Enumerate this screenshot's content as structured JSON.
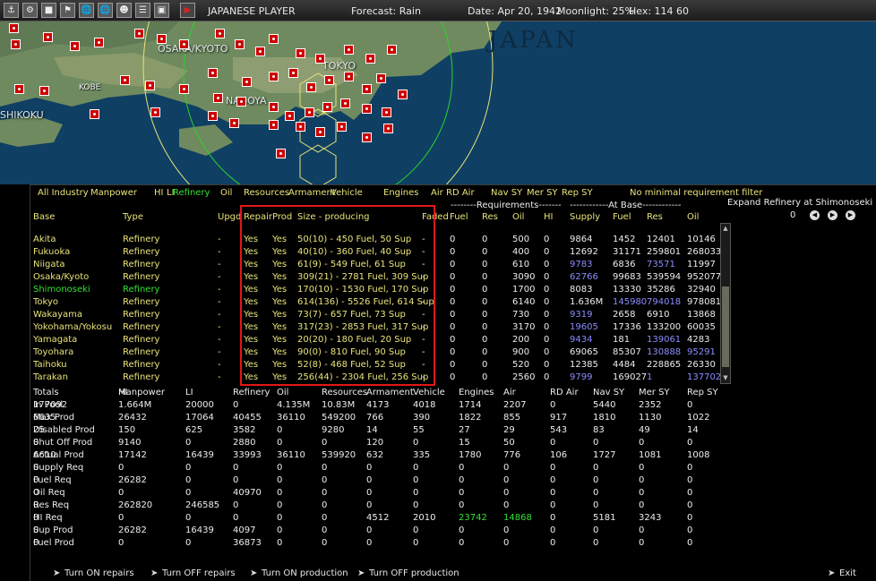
{
  "topbar": {
    "player": "JAPANESE PLAYER",
    "forecast": "Forecast: Rain",
    "date": "Date: Apr 20, 1942",
    "moonlight": "Moonlight: 25%",
    "hex": "Hex: 114 60",
    "icons": [
      "ship-icon",
      "tools-icon",
      "building-icon",
      "flag-icon",
      "globe-icon",
      "globe-icon",
      "manpower-icon",
      "list-icon",
      "window-icon",
      "play-icon"
    ]
  },
  "map": {
    "title": "JAPAN",
    "cities": [
      "OSAKA/KYOTO",
      "TOKYO",
      "NAGOYA",
      "KOBE",
      "SHIKOKU"
    ]
  },
  "filters": [
    "All Industry",
    "Manpower",
    "HI",
    "LI",
    "Refinery",
    "Oil",
    "Resources",
    "Armament",
    "Vehicle",
    "Engines",
    "Air",
    "RD Air",
    "Nav SY",
    "Mer SY",
    "Rep SY",
    "No minimal requirement filter"
  ],
  "active_filter": "Refinery",
  "expand": {
    "label": "Expand Refinery at Shimonoseki",
    "value": "0"
  },
  "groups": {
    "requirements": "--------Requirements-------",
    "atbase": "------------At Base------------"
  },
  "columns": [
    "Base",
    "Type",
    "Upgd",
    "Repair",
    "Prod",
    "Size - producing",
    "Faded",
    "Fuel",
    "Res",
    "Oil",
    "HI",
    "Supply",
    "Fuel",
    "Res",
    "Oil"
  ],
  "rows": [
    {
      "base": "Akita",
      "type": "Refinery",
      "upg": "-",
      "repair": "Yes",
      "prod": "Yes",
      "size": "50(10) - 450 Fuel, 50 Sup",
      "dmg": "-",
      "req_fuel": "0",
      "req_res": "0",
      "req_oil": "500",
      "req_hi": "0",
      "supply": "9864",
      "fuel": "1452",
      "res": "12401",
      "oil": "10146"
    },
    {
      "base": "Fukuoka",
      "type": "Refinery",
      "upg": "-",
      "repair": "Yes",
      "prod": "Yes",
      "size": "40(10) - 360 Fuel, 40 Sup",
      "dmg": "-",
      "req_fuel": "0",
      "req_res": "0",
      "req_oil": "400",
      "req_hi": "0",
      "supply": "12692",
      "fuel": "31171",
      "res": "259801",
      "oil": "268033"
    },
    {
      "base": "Niigata",
      "type": "Refinery",
      "upg": "-",
      "repair": "Yes",
      "prod": "Yes",
      "size": "61(9) - 549 Fuel, 61 Sup",
      "dmg": "-",
      "req_fuel": "0",
      "req_res": "0",
      "req_oil": "610",
      "req_hi": "0",
      "supply": "9783",
      "fuel": "6836",
      "res": "73571",
      "oil": "11997"
    },
    {
      "base": "Osaka/Kyoto",
      "type": "Refinery",
      "upg": "-",
      "repair": "Yes",
      "prod": "Yes",
      "size": "309(21) - 2781 Fuel, 309 Sup",
      "dmg": "-",
      "req_fuel": "0",
      "req_res": "0",
      "req_oil": "3090",
      "req_hi": "0",
      "supply": "62766",
      "fuel": "99683",
      "res": "539594",
      "oil": "952077"
    },
    {
      "base": "Shimonoseki",
      "type": "Refinery",
      "upg": "-",
      "repair": "Yes",
      "prod": "Yes",
      "size": "170(10) - 1530 Fuel, 170 Sup",
      "dmg": "-",
      "req_fuel": "0",
      "req_res": "0",
      "req_oil": "1700",
      "req_hi": "0",
      "supply": "8083",
      "fuel": "13330",
      "res": "35286",
      "oil": "32940"
    },
    {
      "base": "Tokyo",
      "type": "Refinery",
      "upg": "-",
      "repair": "Yes",
      "prod": "Yes",
      "size": "614(136) - 5526 Fuel, 614 Sup",
      "dmg": "-",
      "req_fuel": "0",
      "req_res": "0",
      "req_oil": "6140",
      "req_hi": "0",
      "supply": "1.636M",
      "fuel": "145980",
      "res": "794018",
      "oil": "978081"
    },
    {
      "base": "Wakayama",
      "type": "Refinery",
      "upg": "-",
      "repair": "Yes",
      "prod": "Yes",
      "size": "73(7) - 657 Fuel, 73 Sup",
      "dmg": "-",
      "req_fuel": "0",
      "req_res": "0",
      "req_oil": "730",
      "req_hi": "0",
      "supply": "9319",
      "fuel": "2658",
      "res": "6910",
      "oil": "13868"
    },
    {
      "base": "Yokohama/Yokosu",
      "type": "Refinery",
      "upg": "-",
      "repair": "Yes",
      "prod": "Yes",
      "size": "317(23) - 2853 Fuel, 317 Sup",
      "dmg": "-",
      "req_fuel": "0",
      "req_res": "0",
      "req_oil": "3170",
      "req_hi": "0",
      "supply": "19605",
      "fuel": "17336",
      "res": "133200",
      "oil": "60035"
    },
    {
      "base": "Yamagata",
      "type": "Refinery",
      "upg": "-",
      "repair": "Yes",
      "prod": "Yes",
      "size": "20(20) - 180 Fuel, 20 Sup",
      "dmg": "-",
      "req_fuel": "0",
      "req_res": "0",
      "req_oil": "200",
      "req_hi": "0",
      "supply": "9434",
      "fuel": "181",
      "res": "139061",
      "oil": "4283"
    },
    {
      "base": "Toyohara",
      "type": "Refinery",
      "upg": "-",
      "repair": "Yes",
      "prod": "Yes",
      "size": "90(0) - 810 Fuel, 90 Sup",
      "dmg": "-",
      "req_fuel": "0",
      "req_res": "0",
      "req_oil": "900",
      "req_hi": "0",
      "supply": "69065",
      "fuel": "85307",
      "res": "130888",
      "oil": "95291"
    },
    {
      "base": "Taihoku",
      "type": "Refinery",
      "upg": "-",
      "repair": "Yes",
      "prod": "Yes",
      "size": "52(8) - 468 Fuel, 52 Sup",
      "dmg": "-",
      "req_fuel": "0",
      "req_res": "0",
      "req_oil": "520",
      "req_hi": "0",
      "supply": "12385",
      "fuel": "4484",
      "res": "228865",
      "oil": "26330"
    },
    {
      "base": "Tarakan",
      "type": "Refinery",
      "upg": "-",
      "repair": "Yes",
      "prod": "Yes",
      "size": "256(44) - 2304 Fuel, 256 Sup",
      "dmg": "-",
      "req_fuel": "0",
      "req_res": "0",
      "req_oil": "2560",
      "req_hi": "0",
      "supply": "9799",
      "fuel": "169027",
      "res": "1",
      "oil": "137702"
    }
  ],
  "totals": {
    "header": [
      "Totals",
      "Manpower",
      "HI",
      "LI",
      "Refinery",
      "Oil",
      "Resources",
      "Armament",
      "Vehicle",
      "Engines",
      "Air",
      "RD Air",
      "Nav SY",
      "Mer SY",
      "Rep SY"
    ],
    "rows": [
      {
        "label": "In Pool",
        "values": [
          "177092",
          "1.664M",
          "20000",
          "0",
          "4.135M",
          "10.83M",
          "4173",
          "4018",
          "1714",
          "2207",
          "0",
          "5440",
          "2352",
          "0"
        ]
      },
      {
        "label": "Max Prod",
        "values": [
          "6635",
          "26432",
          "17064",
          "40455",
          "36110",
          "549200",
          "766",
          "390",
          "1822",
          "855",
          "917",
          "1810",
          "1130",
          "1022"
        ]
      },
      {
        "label": "Disabled Prod",
        "values": [
          "25",
          "150",
          "625",
          "3582",
          "0",
          "9280",
          "14",
          "55",
          "27",
          "29",
          "543",
          "83",
          "49",
          "14"
        ]
      },
      {
        "label": "Shut Off Prod",
        "values": [
          "0",
          "9140",
          "0",
          "2880",
          "0",
          "0",
          "120",
          "0",
          "15",
          "50",
          "0",
          "0",
          "0",
          "0"
        ]
      },
      {
        "label": "Actual Prod",
        "values": [
          "6610",
          "17142",
          "16439",
          "33993",
          "36110",
          "539920",
          "632",
          "335",
          "1780",
          "776",
          "106",
          "1727",
          "1081",
          "1008"
        ]
      },
      {
        "label": "Supply Req",
        "values": [
          "0",
          "0",
          "0",
          "0",
          "0",
          "0",
          "0",
          "0",
          "0",
          "0",
          "0",
          "0",
          "0",
          "0"
        ]
      },
      {
        "label": "Fuel Req",
        "values": [
          "0",
          "26282",
          "0",
          "0",
          "0",
          "0",
          "0",
          "0",
          "0",
          "0",
          "0",
          "0",
          "0",
          "0"
        ]
      },
      {
        "label": "Oil Req",
        "values": [
          "0",
          "0",
          "0",
          "40970",
          "0",
          "0",
          "0",
          "0",
          "0",
          "0",
          "0",
          "0",
          "0",
          "0"
        ]
      },
      {
        "label": "Res Req",
        "values": [
          "0",
          "262820",
          "246585",
          "0",
          "0",
          "0",
          "0",
          "0",
          "0",
          "0",
          "0",
          "0",
          "0",
          "0"
        ]
      },
      {
        "label": "HI Req",
        "values": [
          "0",
          "0",
          "0",
          "0",
          "0",
          "0",
          "4512",
          "2010",
          "23742",
          "14868",
          "0",
          "5181",
          "3243",
          "0"
        ]
      },
      {
        "label": "Sup Prod",
        "values": [
          "0",
          "26282",
          "16439",
          "4097",
          "0",
          "0",
          "0",
          "0",
          "0",
          "0",
          "0",
          "0",
          "0",
          "0"
        ]
      },
      {
        "label": "Fuel Prod",
        "values": [
          "0",
          "0",
          "0",
          "36873",
          "0",
          "0",
          "0",
          "0",
          "0",
          "0",
          "0",
          "0",
          "0",
          "0"
        ]
      }
    ]
  },
  "footer": {
    "turn_on_repairs": "Turn ON repairs",
    "turn_off_repairs": "Turn OFF repairs",
    "turn_on_production": "Turn ON production",
    "turn_off_production": "Turn OFF production",
    "exit": "Exit"
  },
  "colors": {
    "header": "#e9e37a",
    "highlight": "#33e033",
    "blue_value": "#8c8cff",
    "red_box": "#e01818"
  }
}
